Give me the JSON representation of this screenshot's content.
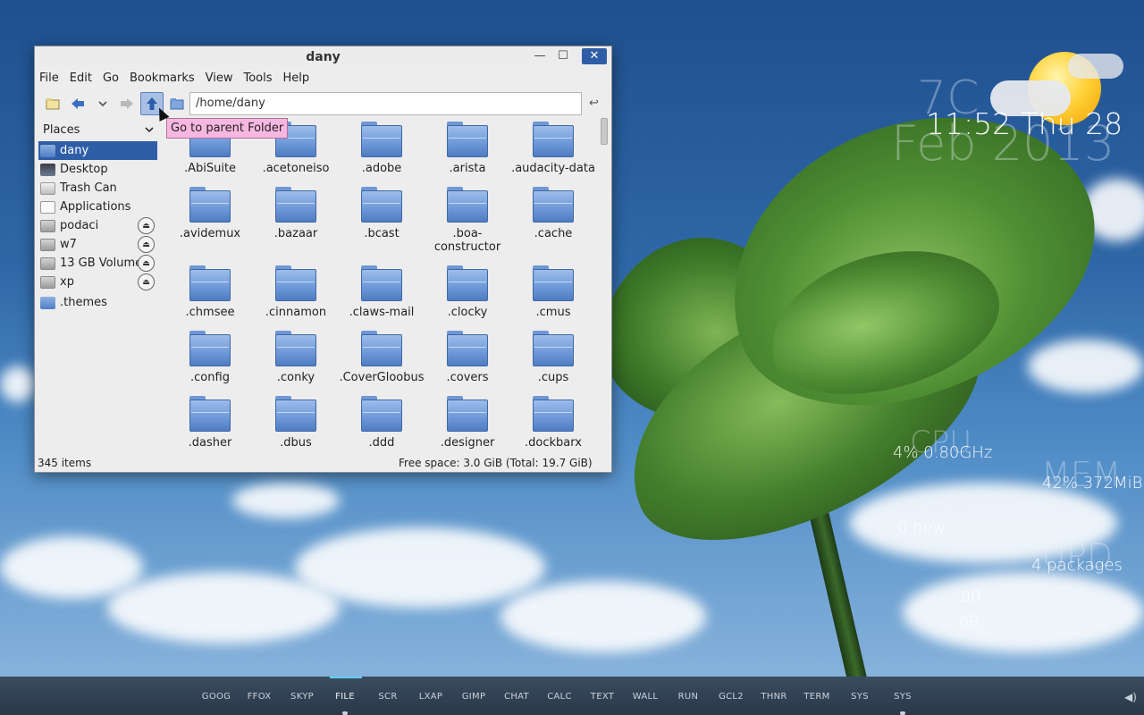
{
  "window": {
    "title": "dany",
    "controls": {
      "minimize": "—",
      "maximize": "☐",
      "close": "✕"
    }
  },
  "menubar": [
    "File",
    "Edit",
    "Go",
    "Bookmarks",
    "View",
    "Tools",
    "Help"
  ],
  "toolbar": {
    "address": "/home/dany",
    "tooltip": "Go to parent Folder"
  },
  "sidebar": {
    "heading": "Places",
    "items": [
      {
        "label": "dany",
        "icon": "home-folder-icon"
      },
      {
        "label": "Desktop",
        "icon": "desktop-icon"
      },
      {
        "label": "Trash Can",
        "icon": "trash-icon"
      },
      {
        "label": "Applications",
        "icon": "applications-icon"
      },
      {
        "label": "podaci",
        "icon": "drive-icon"
      },
      {
        "label": "w7",
        "icon": "drive-icon"
      },
      {
        "label": "13 GB Volume",
        "icon": "drive-icon"
      },
      {
        "label": "xp",
        "icon": "drive-icon"
      },
      {
        "label": ".themes",
        "icon": "folder-icon"
      }
    ]
  },
  "files": [
    {
      "name": ".AbiSuite"
    },
    {
      "name": ".acetoneiso"
    },
    {
      "name": ".adobe"
    },
    {
      "name": ".arista"
    },
    {
      "name": ".audacity-data"
    },
    {
      "name": ".avidemux"
    },
    {
      "name": ".bazaar"
    },
    {
      "name": ".bcast"
    },
    {
      "name": ".boa-",
      "name2": "constructor"
    },
    {
      "name": ".cache"
    },
    {
      "name": ".chmsee"
    },
    {
      "name": ".cinnamon"
    },
    {
      "name": ".claws-mail"
    },
    {
      "name": ".clocky"
    },
    {
      "name": ".cmus"
    },
    {
      "name": ".config"
    },
    {
      "name": ".conky"
    },
    {
      "name": ".CoverGloobus"
    },
    {
      "name": ".covers"
    },
    {
      "name": ".cups"
    },
    {
      "name": ".dasher"
    },
    {
      "name": ".dbus"
    },
    {
      "name": ".ddd"
    },
    {
      "name": ".designer"
    },
    {
      "name": ".dockbarx"
    }
  ],
  "statusbar": {
    "count": "345 items",
    "free_space": "Free space: 3.0 GiB (Total: 19.7 GiB)"
  },
  "conky": {
    "temp_ghost": "7C",
    "time": "11:52 Thu 28",
    "date_ghost": "Feb 2013",
    "cpu_ghost": "CPU",
    "cpu": "4% 0.80GHz",
    "mem_ghost": "MEM",
    "mem": "42% 372MiB",
    "mail_ghost": "MAIL",
    "mail": "0 new",
    "upd_ghost": "UPD",
    "upd": "4 packages",
    "net_ghost": "NET",
    "net_down": "0B",
    "net_up": "0B"
  },
  "dock": {
    "items": [
      "GOOG",
      "FFOX",
      "SKYP",
      "FILE",
      "SCR",
      "LXAP",
      "GIMP",
      "CHAT",
      "CALC",
      "TEXT",
      "WALL",
      "RUN",
      "GCL2",
      "THNR",
      "TERM",
      "SYS",
      "SYS"
    ],
    "active": "FILE",
    "accent": "#5ed0f0"
  },
  "colors": {
    "selection": "#2f5ea7",
    "tooltip": "#f7b7e0",
    "folder": "#6f9ad9"
  }
}
